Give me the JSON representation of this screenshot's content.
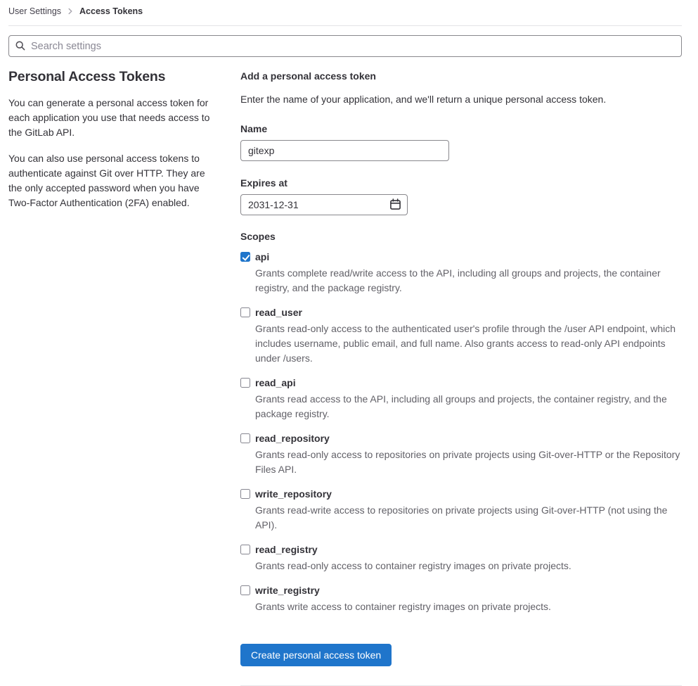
{
  "breadcrumb": {
    "parent": "User Settings",
    "current": "Access Tokens"
  },
  "search": {
    "placeholder": "Search settings"
  },
  "sidebar": {
    "title": "Personal Access Tokens",
    "paragraph1": "You can generate a personal access token for each application you use that needs access to the GitLab API.",
    "paragraph2": "You can also use personal access tokens to authenticate against Git over HTTP. They are the only accepted password when you have Two-Factor Authentication (2FA) enabled."
  },
  "form": {
    "title": "Add a personal access token",
    "description": "Enter the name of your application, and we'll return a unique personal access token.",
    "name_label": "Name",
    "name_value": "gitexp",
    "expires_label": "Expires at",
    "expires_value": "2031-12-31",
    "scopes_label": "Scopes",
    "scopes": [
      {
        "name": "api",
        "checked": true,
        "description": "Grants complete read/write access to the API, including all groups and projects, the container registry, and the package registry."
      },
      {
        "name": "read_user",
        "checked": false,
        "description": "Grants read-only access to the authenticated user's profile through the /user API endpoint, which includes username, public email, and full name. Also grants access to read-only API endpoints under /users."
      },
      {
        "name": "read_api",
        "checked": false,
        "description": "Grants read access to the API, including all groups and projects, the container registry, and the package registry."
      },
      {
        "name": "read_repository",
        "checked": false,
        "description": "Grants read-only access to repositories on private projects using Git-over-HTTP or the Repository Files API."
      },
      {
        "name": "write_repository",
        "checked": false,
        "description": "Grants read-write access to repositories on private projects using Git-over-HTTP (not using the API)."
      },
      {
        "name": "read_registry",
        "checked": false,
        "description": "Grants read-only access to container registry images on private projects."
      },
      {
        "name": "write_registry",
        "checked": false,
        "description": "Grants write access to container registry images on private projects."
      }
    ],
    "submit_label": "Create personal access token"
  },
  "colors": {
    "accent": "#1f75cb",
    "text_primary": "#333238",
    "text_secondary": "#626168",
    "border_input": "#89888d",
    "divider": "#e3e3e6"
  }
}
